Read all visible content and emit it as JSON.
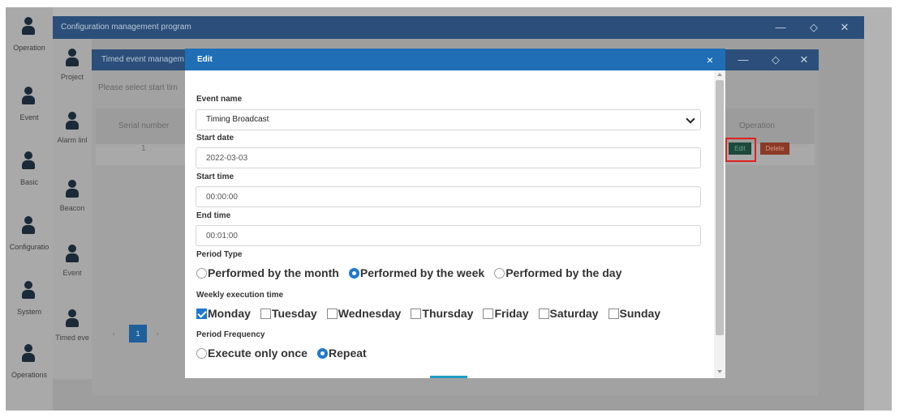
{
  "sidebar": {
    "items": [
      {
        "label": "Operation"
      },
      {
        "label": "Event"
      },
      {
        "label": "Basic"
      },
      {
        "label": "Configuratio"
      },
      {
        "label": "System"
      },
      {
        "label": "Operations"
      }
    ]
  },
  "main_window": {
    "title": "Configuration management program",
    "projects": [
      {
        "label": "Project"
      },
      {
        "label": "Alarm linl"
      },
      {
        "label": "Beacon"
      },
      {
        "label": "Event"
      },
      {
        "label": "Timed eve"
      }
    ]
  },
  "timed_window": {
    "title": "Timed event managem",
    "hint": "Please select start tim",
    "columns": {
      "serial": "Serial number",
      "operation": "Operation"
    },
    "rows": [
      {
        "serial": "1"
      }
    ],
    "edit_label": "Edit",
    "delete_label": "Delete",
    "pager": {
      "current": "1"
    }
  },
  "modal": {
    "title": "Edit",
    "close_glyph": "×",
    "event_name": {
      "label": "Event name",
      "value": "Timing Broadcast"
    },
    "start_date": {
      "label": "Start date",
      "value": "2022-03-03"
    },
    "start_time": {
      "label": "Start time",
      "value": "00:00:00"
    },
    "end_time": {
      "label": "End time",
      "value": "00:01:00"
    },
    "period_type": {
      "label": "Period Type",
      "options": [
        {
          "label": "Performed by the month",
          "checked": false
        },
        {
          "label": "Performed by the week",
          "checked": true
        },
        {
          "label": "Performed by the day",
          "checked": false
        }
      ]
    },
    "weekly": {
      "label": "Weekly execution time",
      "days": [
        {
          "label": "Monday",
          "checked": true
        },
        {
          "label": "Tuesday",
          "checked": false
        },
        {
          "label": "Wednesday",
          "checked": false
        },
        {
          "label": "Thursday",
          "checked": false
        },
        {
          "label": "Friday",
          "checked": false
        },
        {
          "label": "Saturday",
          "checked": false
        },
        {
          "label": "Sunday",
          "checked": false
        }
      ]
    },
    "frequency": {
      "label": "Period Frequency",
      "options": [
        {
          "label": "Execute only once",
          "checked": false
        },
        {
          "label": "Repeat",
          "checked": true
        }
      ]
    }
  },
  "colors": {
    "titlebar": "#2b4f7a",
    "modal_titlebar": "#1f6eb6",
    "accent": "#1f78d1",
    "edit_button": "#1b4a3b",
    "delete_button": "#8a3a26",
    "highlight": "#e02020"
  }
}
